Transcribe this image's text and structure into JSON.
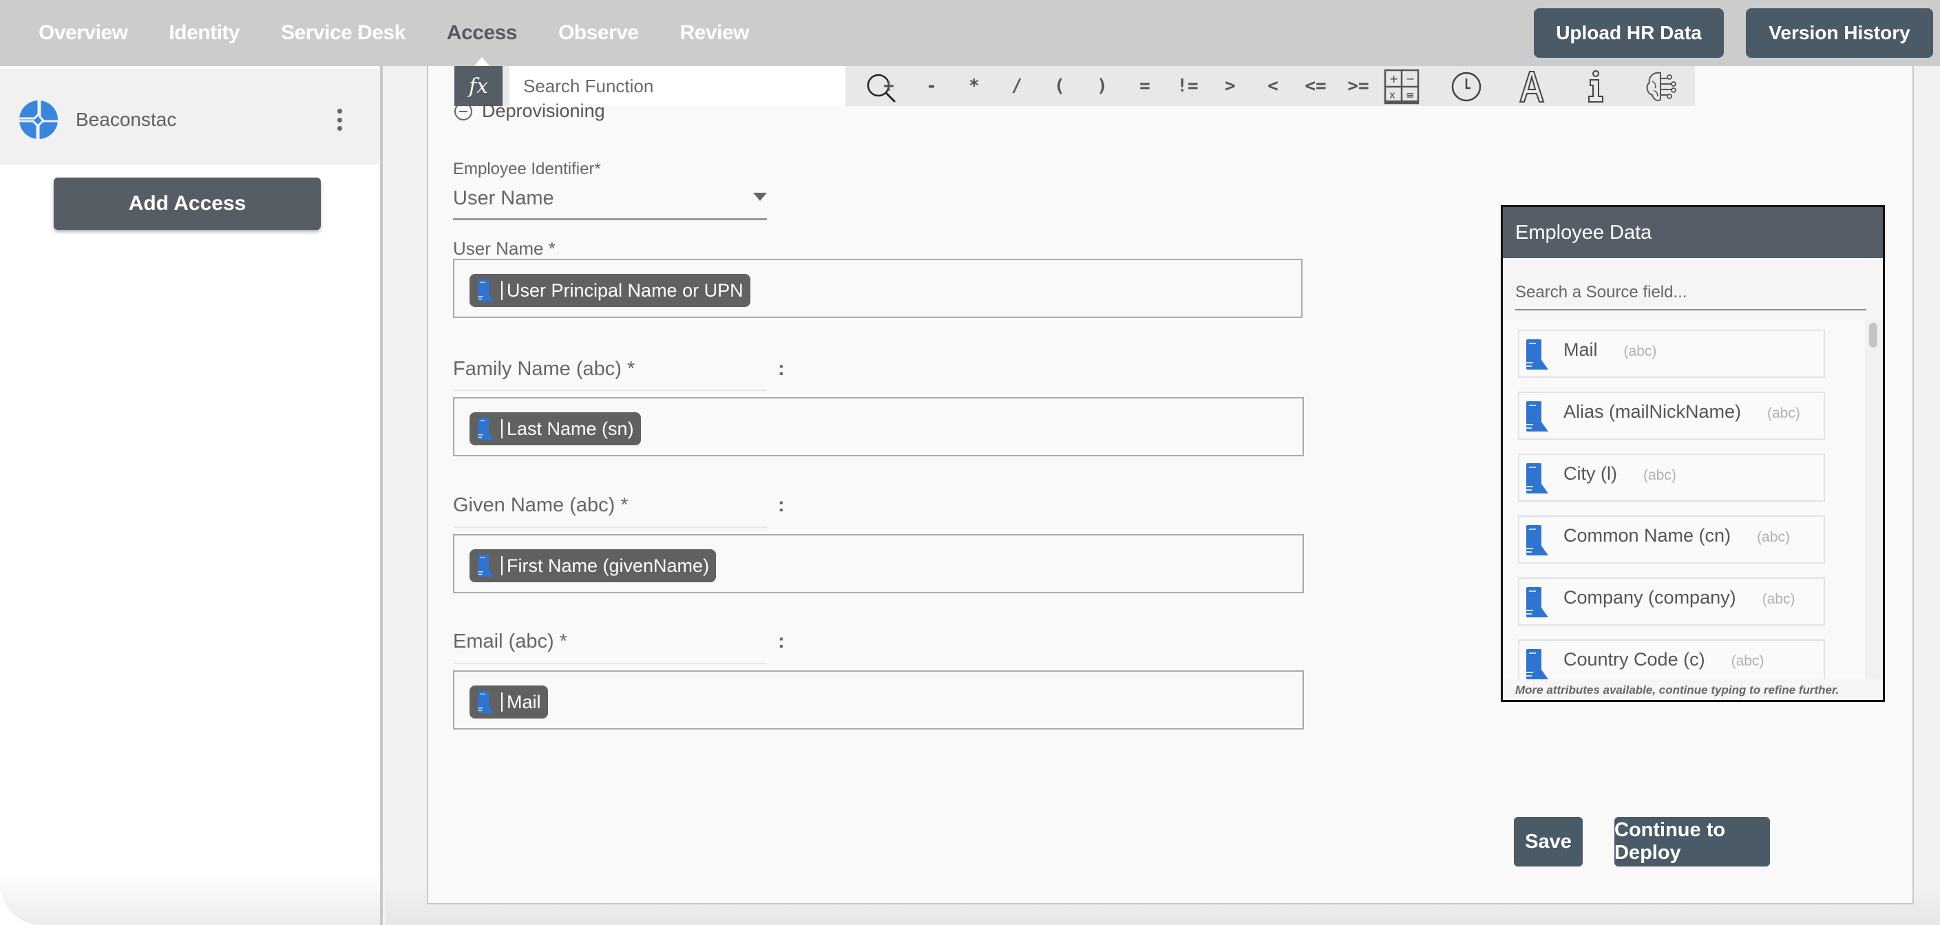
{
  "nav": {
    "items": [
      {
        "label": "Overview",
        "active": false
      },
      {
        "label": "Identity",
        "active": false
      },
      {
        "label": "Service Desk",
        "active": false
      },
      {
        "label": "Access",
        "active": true
      },
      {
        "label": "Observe",
        "active": false
      },
      {
        "label": "Review",
        "active": false
      }
    ],
    "upload_hr_label": "Upload HR Data",
    "version_history_label": "Version History"
  },
  "sidebar": {
    "org_name": "Beaconstac",
    "org_logo_color": "#3a86dc",
    "add_access_label": "Add Access"
  },
  "formula_bar": {
    "fx_label": "fx",
    "search_placeholder": "Search Function",
    "operators": [
      "+",
      "-",
      "*",
      "/",
      "(",
      ")",
      "=",
      "!=",
      ">",
      "<",
      "<=",
      ">="
    ],
    "tools": [
      "calculator-icon",
      "clock-icon",
      "text-icon",
      "info-icon",
      "ai-brain-icon"
    ]
  },
  "section": {
    "title": "Deprovisioning"
  },
  "form": {
    "identifier_label": "Employee Identifier*",
    "identifier_value": "User Name",
    "user_name_label": "User Name *",
    "user_name_chip": "User Principal Name or UPN",
    "mappings": [
      {
        "label": "Family Name (abc) *",
        "separator": ":",
        "chip": "Last Name (sn)"
      },
      {
        "label": "Given Name (abc) *",
        "separator": ":",
        "chip": "First Name (givenName)"
      },
      {
        "label": "Email (abc) *",
        "separator": ":",
        "chip": "Mail"
      }
    ]
  },
  "employee_data": {
    "title": "Employee Data",
    "search_placeholder": "Search a Source field...",
    "fields": [
      {
        "name": "Mail",
        "type": "(abc)"
      },
      {
        "name": "Alias (mailNickName)",
        "type": "(abc)"
      },
      {
        "name": "City (l)",
        "type": "(abc)"
      },
      {
        "name": "Common Name (cn)",
        "type": "(abc)"
      },
      {
        "name": "Company (company)",
        "type": "(abc)"
      },
      {
        "name": "Country Code (c)",
        "type": "(abc)"
      }
    ],
    "more_hint": "More attributes available, continue typing to refine further."
  },
  "actions": {
    "save_label": "Save",
    "deploy_label": "Continue to Deploy"
  },
  "colors": {
    "primary_button": "#4a5a66",
    "dark_header": "#555d66",
    "chip_bg": "#616161",
    "source_icon": "#2f74d0"
  }
}
